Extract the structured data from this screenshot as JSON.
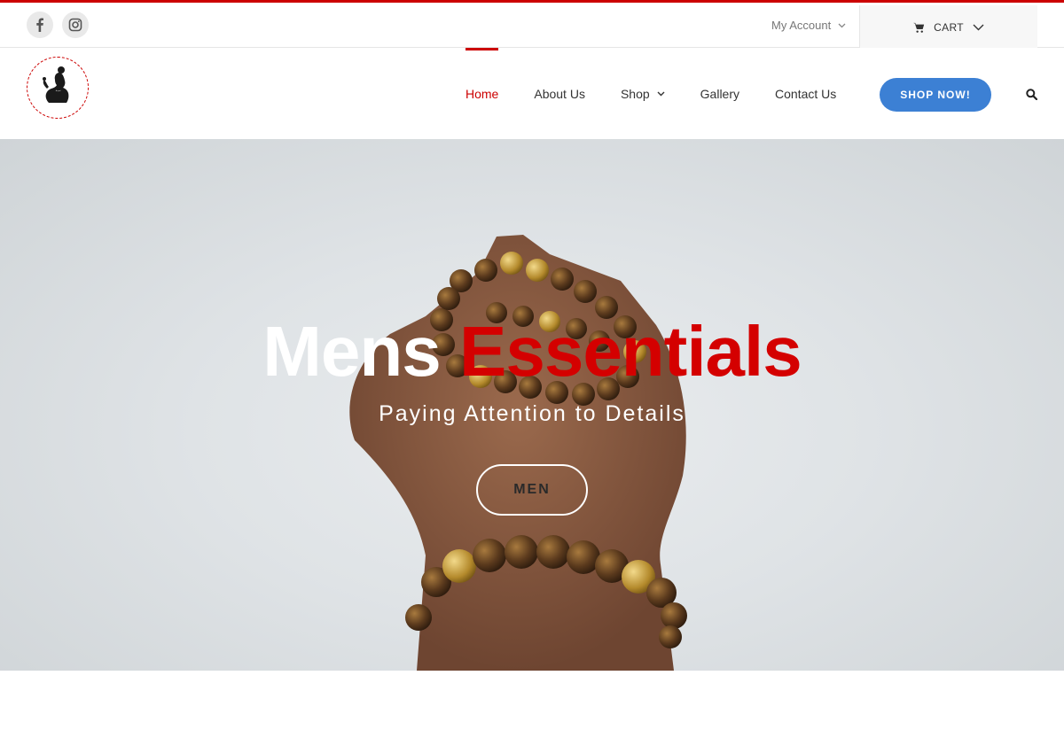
{
  "topbar": {
    "social": [
      {
        "icon": "facebook-icon"
      },
      {
        "icon": "instagram-icon"
      }
    ],
    "account_label": "My Account",
    "cart_label": "CART"
  },
  "header": {
    "logo_icon": "woman-silhouette-logo",
    "nav": [
      {
        "label": "Home",
        "active": true
      },
      {
        "label": "About Us"
      },
      {
        "label": "Shop",
        "has_dropdown": true
      },
      {
        "label": "Gallery"
      },
      {
        "label": "Contact Us"
      }
    ],
    "cta_label": "SHOP NOW!",
    "search_icon": "search-icon"
  },
  "hero": {
    "title_part1": "Mens",
    "title_part2": "Essentials",
    "subtitle": "Paying Attention to Details",
    "button_label": "MEN"
  },
  "colors": {
    "accent_red": "#cc0000",
    "cta_blue": "#3c80d4"
  }
}
